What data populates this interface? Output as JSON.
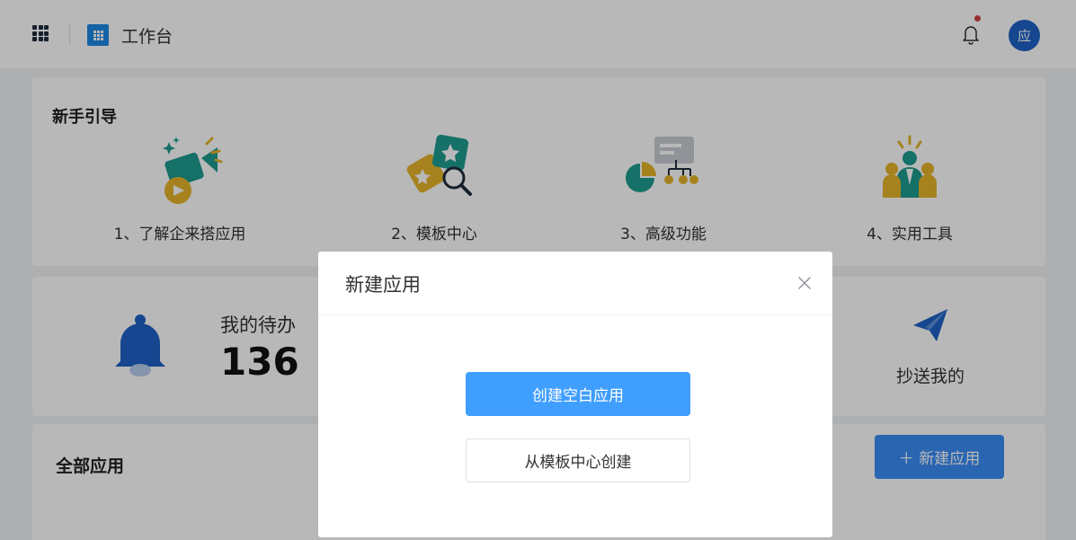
{
  "header": {
    "title": "工作台",
    "avatar_text": "应",
    "grid_icon": "apps-grid-icon",
    "logo_icon": "workbench-logo-icon",
    "bell_icon": "bell-icon"
  },
  "guide": {
    "title": "新手引导",
    "items": [
      {
        "label": "1、了解企来搭应用",
        "icon": "video-camera-icon"
      },
      {
        "label": "2、模板中心",
        "icon": "template-search-icon"
      },
      {
        "label": "3、高级功能",
        "icon": "chart-flow-icon"
      },
      {
        "label": "4、实用工具",
        "icon": "team-people-icon"
      }
    ]
  },
  "stats": {
    "todo_label": "我的待办",
    "todo_count": "136",
    "cc_label": "抄送我的"
  },
  "apps": {
    "title": "全部应用",
    "new_button": "＋ 新建应用"
  },
  "modal": {
    "title": "新建应用",
    "close_icon": "close-icon",
    "primary_button": "创建空白应用",
    "secondary_button": "从模板中心创建"
  },
  "colors": {
    "primary": "#409eff",
    "avatar": "#1e62c6",
    "teal": "#1e9c8f",
    "gold": "#e6b52c"
  }
}
